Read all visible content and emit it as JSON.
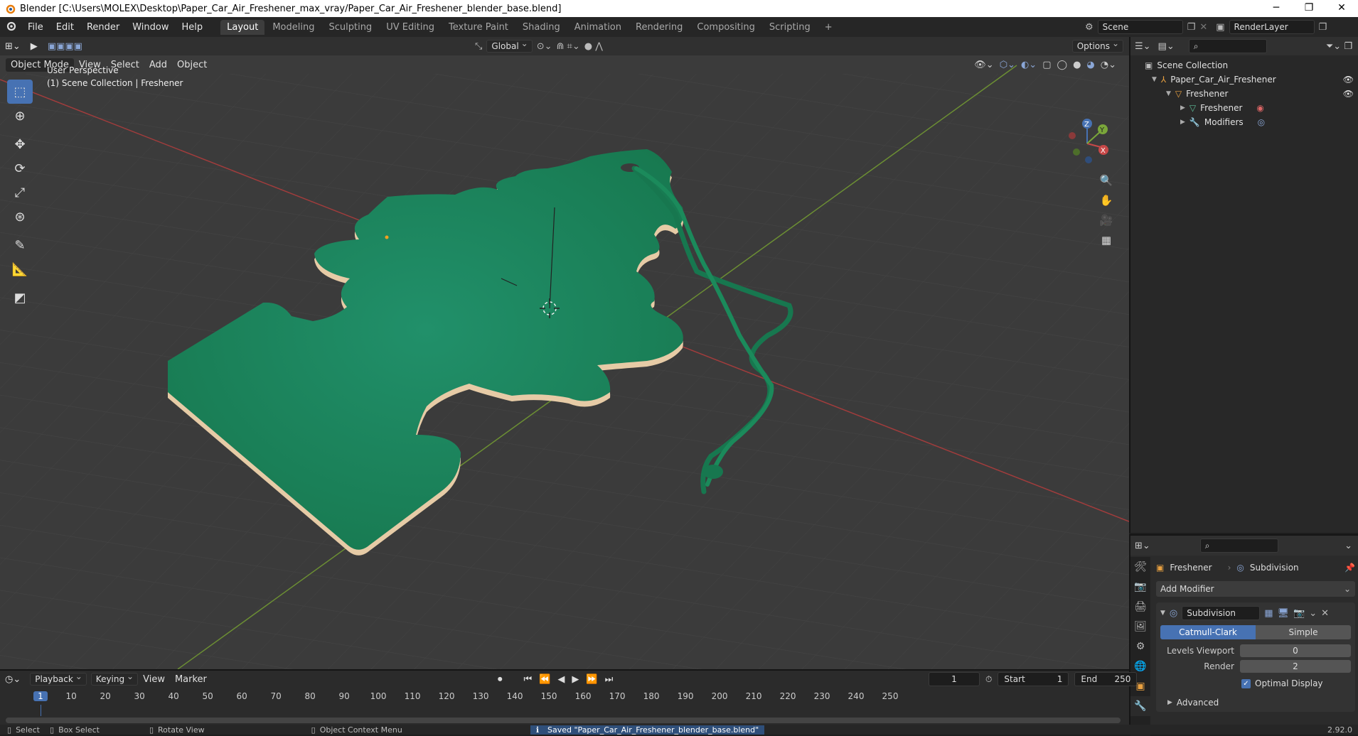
{
  "window": {
    "title": "Blender [C:\\Users\\MOLEX\\Desktop\\Paper_Car_Air_Freshener_max_vray/Paper_Car_Air_Freshener_blender_base.blend]",
    "minimize": "─",
    "restore": "❐",
    "close": "✕"
  },
  "menu": [
    "File",
    "Edit",
    "Render",
    "Window",
    "Help"
  ],
  "workspaces": [
    {
      "label": "Layout",
      "active": true
    },
    {
      "label": "Modeling",
      "active": false
    },
    {
      "label": "Sculpting",
      "active": false
    },
    {
      "label": "UV Editing",
      "active": false
    },
    {
      "label": "Texture Paint",
      "active": false
    },
    {
      "label": "Shading",
      "active": false
    },
    {
      "label": "Animation",
      "active": false
    },
    {
      "label": "Rendering",
      "active": false
    },
    {
      "label": "Compositing",
      "active": false
    },
    {
      "label": "Scripting",
      "active": false
    }
  ],
  "add_workspace": "+",
  "scene": {
    "label": "Scene",
    "layer": "RenderLayer"
  },
  "viewport_header": {
    "transform_orientation": "Global",
    "options": "Options",
    "mode": "Object Mode",
    "menus": [
      "View",
      "Select",
      "Add",
      "Object"
    ]
  },
  "viewport": {
    "perspective": "User Perspective",
    "collection_info": "(1) Scene Collection | Freshener",
    "gizmo": {
      "x": "X",
      "y": "Y",
      "z": "Z"
    }
  },
  "outliner": {
    "title": "Scene Collection",
    "items": [
      {
        "label": "Paper_Car_Air_Freshener",
        "icon": "object-icon"
      },
      {
        "label": "Freshener",
        "icon": "mesh-object-icon"
      },
      {
        "label": "Freshener",
        "icon": "mesh-data-icon"
      },
      {
        "label": "Modifiers",
        "icon": "wrench-icon"
      }
    ]
  },
  "properties": {
    "object_name": "Freshener",
    "modifier_name": "Subdivision",
    "add_modifier": "Add Modifier",
    "modifier": {
      "name": "Subdivision",
      "type_catmull": "Catmull-Clark",
      "type_simple": "Simple",
      "levels_viewport_label": "Levels Viewport",
      "levels_viewport": "0",
      "render_label": "Render",
      "render": "2",
      "optimal_display": "Optimal Display",
      "advanced": "Advanced"
    }
  },
  "timeline": {
    "menus": [
      "Playback",
      "Keying",
      "View",
      "Marker"
    ],
    "current_frame": "1",
    "start_label": "Start",
    "start": "1",
    "end_label": "End",
    "end": "250",
    "ticks": [
      "1",
      "10",
      "20",
      "30",
      "40",
      "50",
      "60",
      "70",
      "80",
      "90",
      "100",
      "110",
      "120",
      "130",
      "140",
      "150",
      "160",
      "170",
      "180",
      "190",
      "200",
      "210",
      "220",
      "230",
      "240",
      "250"
    ]
  },
  "status": {
    "select": "Select",
    "box_select": "Box Select",
    "rotate_view": "Rotate View",
    "context_menu": "Object Context Menu",
    "message": "Saved \"Paper_Car_Air_Freshener_blender_base.blend\"",
    "version": "2.92.0"
  },
  "colors": {
    "accent": "#4772b3",
    "freshener": "#1e8a5c",
    "edge": "#e8cfae",
    "x_axis": "#b44040",
    "y_axis": "#7aa63a"
  }
}
